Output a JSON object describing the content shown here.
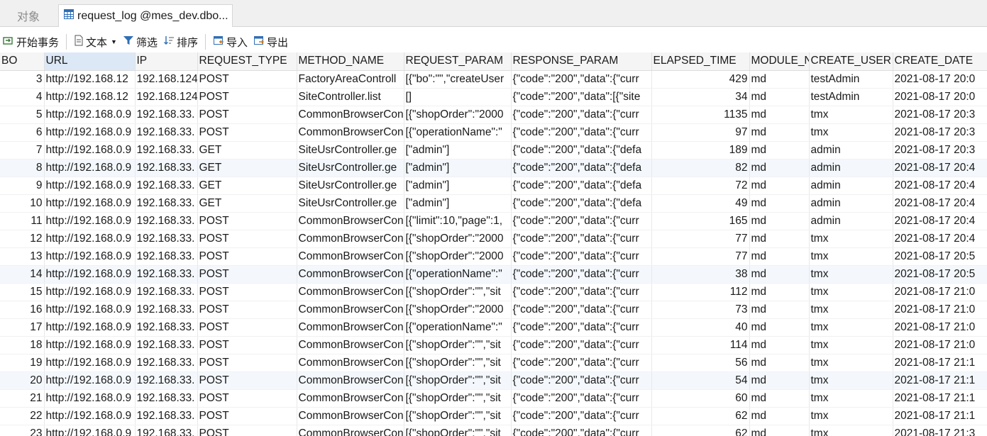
{
  "tabs": {
    "objects": "对象",
    "active": "request_log @mes_dev.dbo..."
  },
  "toolbar": {
    "begin_transaction": "开始事务",
    "text": "文本",
    "filter": "筛选",
    "sort": "排序",
    "import": "导入",
    "export": "导出"
  },
  "columns": [
    "BO",
    "URL",
    "IP",
    "REQUEST_TYPE",
    "METHOD_NAME",
    "REQUEST_PARAM",
    "RESPONSE_PARAM",
    "ELAPSED_TIME",
    "MODULE_N",
    "CREATE_USER",
    "CREATE_DATE"
  ],
  "rows": [
    [
      "3",
      "http://192.168.12",
      "192.168.124",
      "POST",
      "FactoryAreaControll",
      "[{\"bo\":\"\",\"createUser",
      "{\"code\":\"200\",\"data\":{\"curr",
      "429",
      "md",
      "testAdmin",
      "2021-08-17 20:0"
    ],
    [
      "4",
      "http://192.168.12",
      "192.168.124",
      "POST",
      "SiteController.list",
      "[]",
      "{\"code\":\"200\",\"data\":[{\"site",
      "34",
      "md",
      "testAdmin",
      "2021-08-17 20:0"
    ],
    [
      "5",
      "http://192.168.0.9",
      "192.168.33.",
      "POST",
      "CommonBrowserCon",
      "[{\"shopOrder\":\"2000",
      "{\"code\":\"200\",\"data\":{\"curr",
      "1135",
      "md",
      "tmx",
      "2021-08-17 20:3"
    ],
    [
      "6",
      "http://192.168.0.9",
      "192.168.33.",
      "POST",
      "CommonBrowserCon",
      "[{\"operationName\":\"",
      "{\"code\":\"200\",\"data\":{\"curr",
      "97",
      "md",
      "tmx",
      "2021-08-17 20:3"
    ],
    [
      "7",
      "http://192.168.0.9",
      "192.168.33.",
      "GET",
      "SiteUsrController.ge",
      "[\"admin\"]",
      "{\"code\":\"200\",\"data\":{\"defa",
      "189",
      "md",
      "admin",
      "2021-08-17 20:3"
    ],
    [
      "8",
      "http://192.168.0.9",
      "192.168.33.",
      "GET",
      "SiteUsrController.ge",
      "[\"admin\"]",
      "{\"code\":\"200\",\"data\":{\"defa",
      "82",
      "md",
      "admin",
      "2021-08-17 20:4"
    ],
    [
      "9",
      "http://192.168.0.9",
      "192.168.33.",
      "GET",
      "SiteUsrController.ge",
      "[\"admin\"]",
      "{\"code\":\"200\",\"data\":{\"defa",
      "72",
      "md",
      "admin",
      "2021-08-17 20:4"
    ],
    [
      "10",
      "http://192.168.0.9",
      "192.168.33.",
      "GET",
      "SiteUsrController.ge",
      "[\"admin\"]",
      "{\"code\":\"200\",\"data\":{\"defa",
      "49",
      "md",
      "admin",
      "2021-08-17 20:4"
    ],
    [
      "11",
      "http://192.168.0.9",
      "192.168.33.",
      "POST",
      "CommonBrowserCon",
      "[{\"limit\":10,\"page\":1,",
      "{\"code\":\"200\",\"data\":{\"curr",
      "165",
      "md",
      "admin",
      "2021-08-17 20:4"
    ],
    [
      "12",
      "http://192.168.0.9",
      "192.168.33.",
      "POST",
      "CommonBrowserCon",
      "[{\"shopOrder\":\"2000",
      "{\"code\":\"200\",\"data\":{\"curr",
      "77",
      "md",
      "tmx",
      "2021-08-17 20:4"
    ],
    [
      "13",
      "http://192.168.0.9",
      "192.168.33.",
      "POST",
      "CommonBrowserCon",
      "[{\"shopOrder\":\"2000",
      "{\"code\":\"200\",\"data\":{\"curr",
      "77",
      "md",
      "tmx",
      "2021-08-17 20:5"
    ],
    [
      "14",
      "http://192.168.0.9",
      "192.168.33.",
      "POST",
      "CommonBrowserCon",
      "[{\"operationName\":\"",
      "{\"code\":\"200\",\"data\":{\"curr",
      "38",
      "md",
      "tmx",
      "2021-08-17 20:5"
    ],
    [
      "15",
      "http://192.168.0.9",
      "192.168.33.",
      "POST",
      "CommonBrowserCon",
      "[{\"shopOrder\":\"\",\"sit",
      "{\"code\":\"200\",\"data\":{\"curr",
      "112",
      "md",
      "tmx",
      "2021-08-17 21:0"
    ],
    [
      "16",
      "http://192.168.0.9",
      "192.168.33.",
      "POST",
      "CommonBrowserCon",
      "[{\"shopOrder\":\"2000",
      "{\"code\":\"200\",\"data\":{\"curr",
      "73",
      "md",
      "tmx",
      "2021-08-17 21:0"
    ],
    [
      "17",
      "http://192.168.0.9",
      "192.168.33.",
      "POST",
      "CommonBrowserCon",
      "[{\"operationName\":\"",
      "{\"code\":\"200\",\"data\":{\"curr",
      "40",
      "md",
      "tmx",
      "2021-08-17 21:0"
    ],
    [
      "18",
      "http://192.168.0.9",
      "192.168.33.",
      "POST",
      "CommonBrowserCon",
      "[{\"shopOrder\":\"\",\"sit",
      "{\"code\":\"200\",\"data\":{\"curr",
      "114",
      "md",
      "tmx",
      "2021-08-17 21:0"
    ],
    [
      "19",
      "http://192.168.0.9",
      "192.168.33.",
      "POST",
      "CommonBrowserCon",
      "[{\"shopOrder\":\"\",\"sit",
      "{\"code\":\"200\",\"data\":{\"curr",
      "56",
      "md",
      "tmx",
      "2021-08-17 21:1"
    ],
    [
      "20",
      "http://192.168.0.9",
      "192.168.33.",
      "POST",
      "CommonBrowserCon",
      "[{\"shopOrder\":\"\",\"sit",
      "{\"code\":\"200\",\"data\":{\"curr",
      "54",
      "md",
      "tmx",
      "2021-08-17 21:1"
    ],
    [
      "21",
      "http://192.168.0.9",
      "192.168.33.",
      "POST",
      "CommonBrowserCon",
      "[{\"shopOrder\":\"\",\"sit",
      "{\"code\":\"200\",\"data\":{\"curr",
      "60",
      "md",
      "tmx",
      "2021-08-17 21:1"
    ],
    [
      "22",
      "http://192.168.0.9",
      "192.168.33.",
      "POST",
      "CommonBrowserCon",
      "[{\"shopOrder\":\"\",\"sit",
      "{\"code\":\"200\",\"data\":{\"curr",
      "62",
      "md",
      "tmx",
      "2021-08-17 21:1"
    ],
    [
      "23",
      "http://192.168.0.9",
      "192.168.33.",
      "POST",
      "CommonBrowserCon",
      "[{\"shopOrder\":\"\",\"sit",
      "{\"code\":\"200\",\"data\":{\"curr",
      "62",
      "md",
      "tmx",
      "2021-08-17 21:3"
    ]
  ],
  "highlighted_rows": [
    "8",
    "14",
    "20"
  ],
  "selected_column": "URL",
  "colors": {
    "row_highlight": "#f4f8fd",
    "header_selected": "#dce8f5",
    "icon_blue": "#2f6fb5"
  }
}
